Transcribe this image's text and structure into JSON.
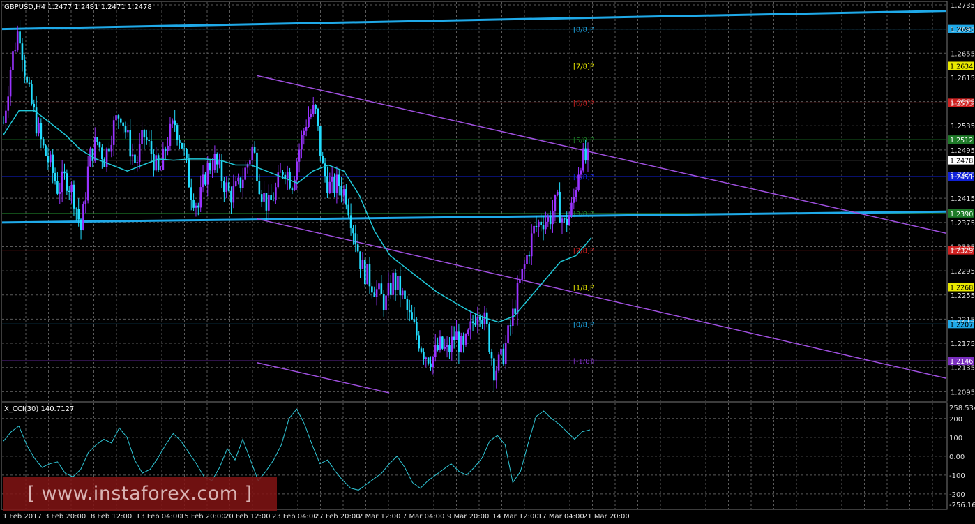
{
  "header": {
    "main_info": "GBPUSD,H4  1.2477 1.2481 1.2471 1.2478",
    "indicator_info": "X_CCI(30) 140.7127"
  },
  "colors": {
    "background": "#000000",
    "grid": "#5a5a5a",
    "bull_candle": "#9933ff",
    "bear_candle": "#22ddff",
    "ma_line": "#20c8d8",
    "channel_blue": "#1fa9e8",
    "channel_violet": "#a050e0",
    "cci_line": "#30c8d8"
  },
  "watermark": "[ www.instaforex.com ]",
  "chart_data": [
    {
      "type": "candlestick",
      "symbol": "GBPUSD",
      "timeframe": "H4",
      "ylim": [
        1.2085,
        1.2735
      ],
      "y_ticks": [
        "1.2735",
        "1.2695",
        "1.2655",
        "1.2615",
        "1.2575",
        "1.2535",
        "1.2495",
        "1.2455",
        "1.2415",
        "1.2375",
        "1.2335",
        "1.2295",
        "1.2255",
        "1.2215",
        "1.2175",
        "1.2135",
        "1.2095"
      ],
      "x_ticks": [
        "1 Feb 2017",
        "3 Feb 20:00",
        "8 Feb 12:00",
        "13 Feb 04:00",
        "15 Feb 20:00",
        "20 Feb 12:00",
        "23 Feb 04:00",
        "27 Feb 20:00",
        "2 Mar 12:00",
        "7 Mar 04:00",
        "9 Mar 20:00",
        "14 Mar 12:00",
        "17 Mar 04:00",
        "21 Mar 20:00"
      ],
      "murrey_levels": [
        {
          "label": "[8/8]P",
          "price": "1.2695",
          "value": 1.2695,
          "color": "#1fa9e8",
          "text_color": "#1fa9e8"
        },
        {
          "label": "[7/8]P",
          "price": "1.2634",
          "value": 1.2634,
          "color": "#e8e800",
          "text_color": "#e8e800"
        },
        {
          "label": "[6/8]P",
          "price": "1.2573",
          "value": 1.2573,
          "color": "#d02020",
          "text_color": "#d02020"
        },
        {
          "label": "[5/8]P",
          "price": "1.2512",
          "value": 1.2512,
          "color": "#1e7a28",
          "text_color": "#1e7a28"
        },
        {
          "label": "[4/8]P",
          "price": "1.2451",
          "value": 1.2451,
          "color": "#1020d8",
          "text_color": "#1020d8"
        },
        {
          "label": "[3/8]P",
          "price": "1.2390",
          "value": 1.239,
          "color": "#1e7a28",
          "text_color": "#1e7a28"
        },
        {
          "label": "[2/8]P",
          "price": "1.2329",
          "value": 1.2329,
          "color": "#d02020",
          "text_color": "#d02020"
        },
        {
          "label": "[1/8]P",
          "price": "1.2268",
          "value": 1.2268,
          "color": "#e8e800",
          "text_color": "#e8e800"
        },
        {
          "label": "[0/8]P",
          "price": "1.2207",
          "value": 1.2207,
          "color": "#1fa9e8",
          "text_color": "#1fa9e8"
        },
        {
          "label": "[-1/8]P",
          "price": "1.2146",
          "value": 1.2146,
          "color": "#7b2fbf",
          "text_color": "#7b2fbf"
        }
      ],
      "current_price": {
        "price": "1.2478",
        "value": 1.2478
      },
      "ohlc_path": [
        1.254,
        1.264,
        1.27,
        1.26,
        1.255,
        1.25,
        1.247,
        1.243,
        1.245,
        1.242,
        1.236,
        1.248,
        1.251,
        1.248,
        1.253,
        1.256,
        1.251,
        1.247,
        1.252,
        1.249,
        1.245,
        1.251,
        1.254,
        1.25,
        1.243,
        1.24,
        1.246,
        1.248,
        1.245,
        1.242,
        1.243,
        1.246,
        1.25,
        1.243,
        1.24,
        1.243,
        1.247,
        1.244,
        1.25,
        1.255,
        1.256,
        1.246,
        1.243,
        1.244,
        1.242,
        1.236,
        1.23,
        1.228,
        1.226,
        1.224,
        1.228,
        1.226,
        1.222,
        1.219,
        1.216,
        1.215,
        1.217,
        1.216,
        1.219,
        1.216,
        1.22,
        1.224,
        1.22,
        1.213,
        1.215,
        1.22,
        1.226,
        1.231,
        1.236,
        1.238,
        1.238,
        1.241,
        1.237,
        1.24,
        1.248,
        1.2478
      ],
      "moving_average": [
        1.252,
        1.256,
        1.256,
        1.254,
        1.252,
        1.2495,
        1.248,
        1.247,
        1.246,
        1.247,
        1.248,
        1.2478,
        1.248,
        1.248,
        1.2478,
        1.247,
        1.247,
        1.246,
        1.245,
        1.244,
        1.246,
        1.247,
        1.246,
        1.242,
        1.236,
        1.232,
        1.23,
        1.228,
        1.226,
        1.2245,
        1.223,
        1.2218,
        1.221,
        1.222,
        1.225,
        1.228,
        1.231,
        1.232,
        1.235
      ],
      "channel_lines": [
        {
          "name": "upper-blue",
          "x1": 0,
          "y1": 1.2695,
          "x2": 1,
          "y2": 1.2725,
          "color": "#1fa9e8",
          "width": 3
        },
        {
          "name": "lower-blue",
          "x1": 0,
          "y1": 1.2375,
          "x2": 1,
          "y2": 1.2393,
          "color": "#1fa9e8",
          "width": 3
        },
        {
          "name": "violet-top",
          "x1": 0.27,
          "y1": 1.2618,
          "x2": 1,
          "y2": 1.2357,
          "color": "#a050e0",
          "width": 1.5
        },
        {
          "name": "violet-mid",
          "x1": 0.27,
          "y1": 1.2381,
          "x2": 1,
          "y2": 1.2117,
          "color": "#a050e0",
          "width": 1.5
        },
        {
          "name": "violet-bottom",
          "x1": 0.27,
          "y1": 1.2143,
          "x2": 0.41,
          "y2": 1.2093,
          "color": "#a050e0",
          "width": 1.5
        }
      ]
    },
    {
      "type": "line",
      "name": "X_CCI(30)",
      "value": 140.7127,
      "ylim": [
        -256.162,
        258.534
      ],
      "y_ticks": [
        "258.534",
        "200",
        "100",
        "0.00",
        "-100",
        "-200",
        "-256.162"
      ],
      "values": [
        80,
        130,
        160,
        60,
        -10,
        -60,
        -40,
        -30,
        -90,
        -110,
        -70,
        20,
        60,
        90,
        70,
        150,
        100,
        -20,
        -90,
        -70,
        -10,
        60,
        120,
        80,
        20,
        -40,
        -110,
        -130,
        -60,
        40,
        -20,
        90,
        -20,
        -130,
        -80,
        -20,
        60,
        200,
        250,
        170,
        60,
        -40,
        -20,
        -80,
        -130,
        -170,
        -180,
        -150,
        -120,
        -90,
        -40,
        0,
        -60,
        -140,
        -170,
        -130,
        -100,
        -70,
        -40,
        -80,
        -100,
        -60,
        -10,
        80,
        110,
        60,
        -140,
        -80,
        70,
        210,
        240,
        200,
        170,
        130,
        90,
        130,
        140
      ]
    }
  ]
}
